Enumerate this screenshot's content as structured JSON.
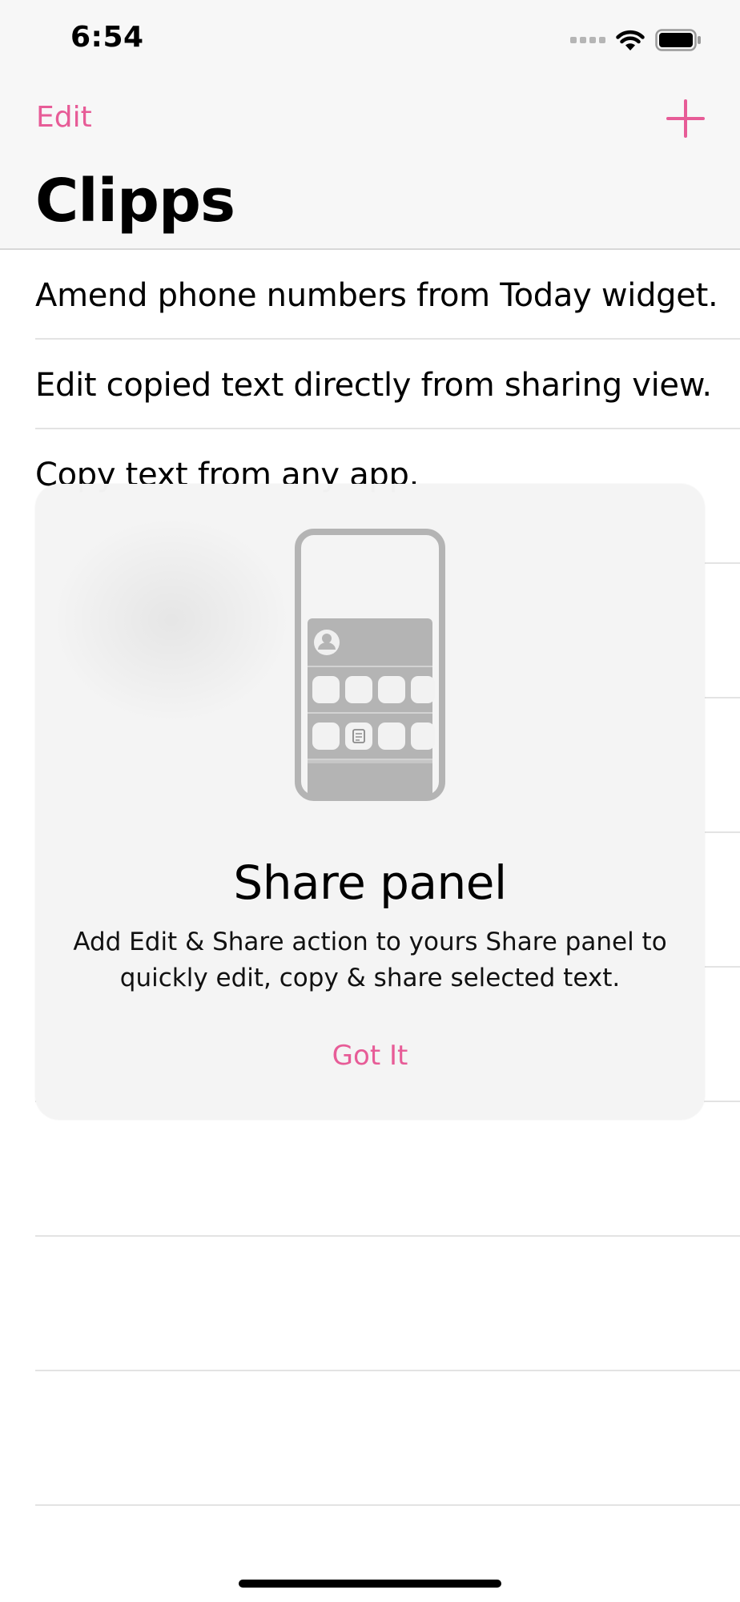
{
  "status_bar": {
    "time": "6:54"
  },
  "nav": {
    "edit_label": "Edit",
    "add_icon": "plus-icon",
    "title": "Clipps"
  },
  "clips": [
    "Amend phone numbers from Today widget.",
    "Edit copied text directly from sharing view.",
    "Copy text from any app.",
    "",
    "",
    "",
    "",
    "",
    "",
    "",
    ""
  ],
  "onboarding": {
    "title": "Share panel",
    "description": "Add Edit & Share action to yours Share panel to quickly edit, copy & share selected text.",
    "button_label": "Got It",
    "illustration_icon": "phone-share-sheet-illustration"
  },
  "colors": {
    "accent": "#e75c97",
    "nav_background": "#f7f7f7",
    "sheet_background": "#f4f4f4"
  }
}
